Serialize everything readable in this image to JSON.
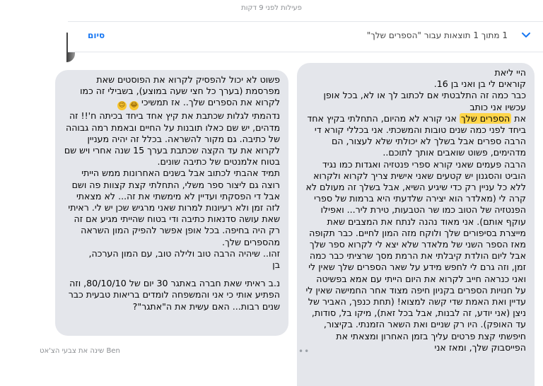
{
  "status": {
    "active": "פעילות לפני 9 דקות"
  },
  "search": {
    "done_label": "סיום",
    "results_text": "1 מתוך 1 תוצאות עבור \"הספרים שלך\""
  },
  "messages": {
    "left": {
      "p1": "פשוט לא יכול להפסיק לקרוא את הפוסטים שאת מפרסמת (בערך כל חצי שעה במוצע), בשבילי זה כמו לקרוא את הספרים שלך.. אז תמשיכי",
      "p2": "נדהמתי לגלות שכתבת את קיץ אחד ביחד בכיתה ח'!! זה מדהים, יש שם כאלו תובנות על החיים ובאמת רמה גבוהה של כתיבה. גם מקור להשראה. בכלל זה יהיה מעניין לקרוא את עד הקצה שכתבת בערך 15 שנה אחרי ויש שם בטוח אלמנטים של כתיבה שונים.",
      "p3": "תמיד אהבתי לכתוב אבל בשנים האחרונות ממש הייתי רוצה גם ליצור ספר משלי, התחלתי קצת קצוות פה ושם אבל די הפסקתי ועדיין לא מימשתי את זה... לא מצאתי לזה זמן ולא רעיונות למרות שאני מרגיש שכן יש לי. ראיתי שאת עושה סדנאות כתיבה ודי בטוח שהייתי מגיע אם זה רק היה בחיפה. בכל אופן אפשר להפיק המון השראה מהספרים שלך.",
      "p4": "זהו.. שיהיה הרבה טוב ולילה טוב, עם המון הערכה,",
      "p5": "בן",
      "p6": "נ.ב ראיתי שאת חברה באתגר 30 יום של 80/10/10, וזה הפתיע אותי כי אני והמשפחה לומדים בריאות טבעית כבר שנים רבות... האם עשית את ה\"אתגר\"?"
    },
    "right": {
      "l1": "היי ליאת",
      "l2": "קוראים לי בן ואני בן 16.",
      "l3": "כבר כמה זה התלבטתי אם לכתוב לך או לא, בכל אופן עכשיו אני כותב",
      "h_pre": "את ",
      "highlight": "הספרים שלך",
      "h_post": " אני קורא לא מהיום, התחלתי בקיץ אחד ביחד לפני כמה שנים טובות והמשכתי. אני בכללי קורא די הרבה ספרים אבל בשלך לא יכולתי שלא לעצור, הם מדהימים, פשוט שואבים אותך לתוכם..",
      "p2": "הרבה פעמים שאני קורא ספרי פנטזיה ואגדות כמו נגיד הוביט והסגנון יש קטעים שאני אישית צריך לקרוא ולקרוא ללא כל עניין רק כדי שיגיע השיא, אבל בשלך זה מעולם לא קרה לי (מאלדר הוא יצירה שלדעתי היא ברמות של ספרי הפנטזיה של הטוב כמו שר הטבעות, טירת ליר... ואפילו עוקף אותם). אני מאוד נהנה לנתח את המצבים שאת מייצרת בסיפורים שלך ולוקח מזה המון לחיים. כבר תקופה מאז הספר השני של מלאדר שלא יצא לי לקרוא ספר שלך אבל ליום הולדת קיבלתי את הרמת מסך שרציתי כבר כמה זמן, וזה גרם לי לחפש מידע על שאר הספרים שלך שאין לי ואני כנראה חייב לקרוא את היום הייתי עם אמא בפשיטה על חנויות הספרים בקניון חיפה מצוד אחר החמישה שאין לי עדיין ואת האמת שדי קשה למצוא! (תחת כנפך, האביר של ניצן (אני יודע, זה לבנות, אבל בכל זאת), מיקו בל, סודות, עד האופק). היו רק שניים ואת השאר הזמנתי. בקיצור, חיפשתי קצת פרטים עליך בזמן האחרון ומצאתי את הפייסבוק שלך, ומאז אני"
    }
  },
  "footer": {
    "note": "Ben שינה את צבעי הצ'אט"
  },
  "icons": {
    "chevron": "chevron-down-icon",
    "emoji_laugh": "laughing-emoji-icon",
    "emoji_wink": "wink-emoji-icon"
  },
  "colors": {
    "accent": "#1877f2",
    "bubble": "#e4e6eb",
    "highlight": "#ffd54a"
  }
}
